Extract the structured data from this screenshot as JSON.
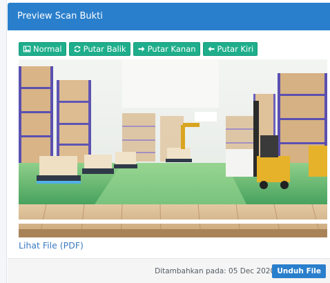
{
  "modal": {
    "title": "Preview Scan Bukti"
  },
  "toolbar": {
    "normal_label": "Normal",
    "flip_label": "Putar Balik",
    "rotate_right_label": "Putar Kanan",
    "rotate_left_label": "Putar Kiri"
  },
  "icons": {
    "normal": "image-icon",
    "flip": "refresh-icon",
    "rotate_right": "arrow-right-icon",
    "rotate_left": "arrow-left-icon"
  },
  "file_link": "Lihat File (PDF)",
  "footer": {
    "added_text": "Ditambahkan pada: 05 Dec 2020 /",
    "download_label": "Unduh File"
  },
  "colors": {
    "header": "#2a7fcc",
    "toolbar_button": "#1fae8b",
    "link": "#3a7ac0",
    "footer_bg": "#f5f5f5"
  }
}
